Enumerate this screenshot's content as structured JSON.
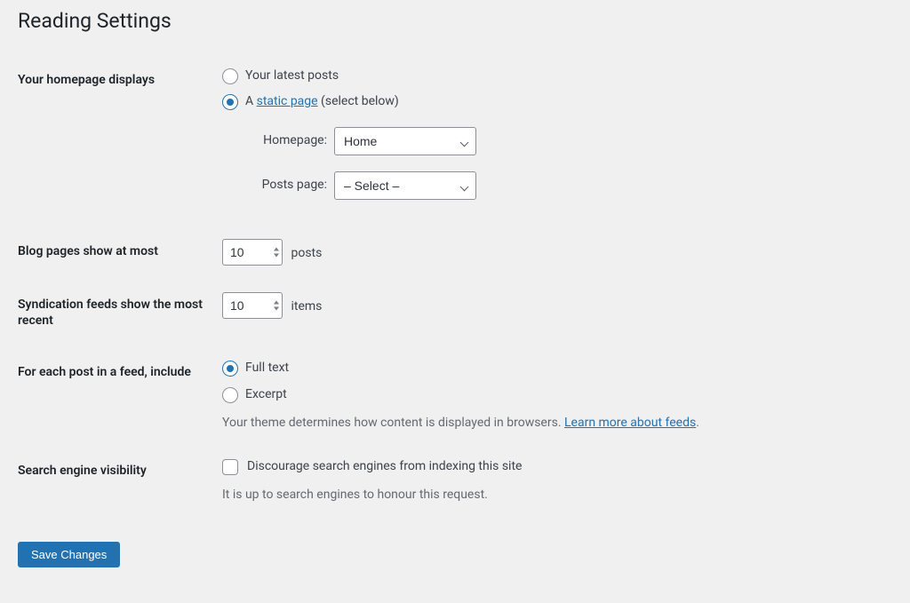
{
  "page_title": "Reading Settings",
  "homepage_displays": {
    "label": "Your homepage displays",
    "option_latest": "Your latest posts",
    "option_static_prefix": "A ",
    "option_static_link": "static page",
    "option_static_suffix": " (select below)",
    "homepage_label": "Homepage:",
    "homepage_value": "Home",
    "posts_page_label": "Posts page:",
    "posts_page_value": "– Select –"
  },
  "blog_pages": {
    "label": "Blog pages show at most",
    "value": "10",
    "unit": "posts"
  },
  "syndication": {
    "label": "Syndication feeds show the most recent",
    "value": "10",
    "unit": "items"
  },
  "feed_content": {
    "label": "For each post in a feed, include",
    "option_full": "Full text",
    "option_excerpt": "Excerpt",
    "description_prefix": "Your theme determines how content is displayed in browsers. ",
    "description_link": "Learn more about feeds",
    "description_suffix": "."
  },
  "search_visibility": {
    "label": "Search engine visibility",
    "checkbox_label": "Discourage search engines from indexing this site",
    "note": "It is up to search engines to honour this request."
  },
  "save_button": "Save Changes"
}
